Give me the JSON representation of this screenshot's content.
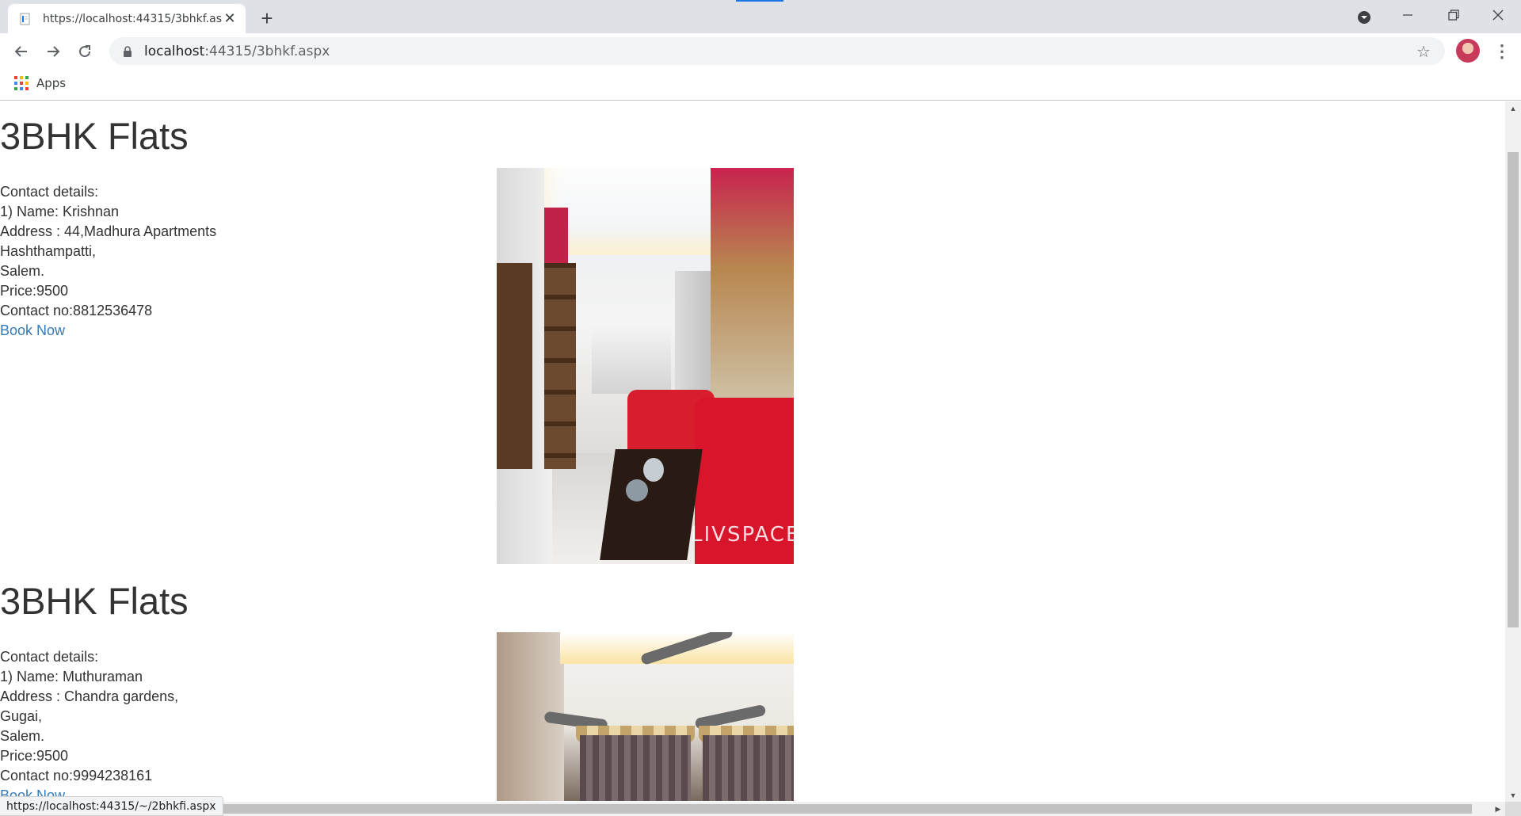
{
  "browser": {
    "tab_title": "https://localhost:44315/3bhkf.aspx",
    "new_tab_label": "+",
    "url_host": "localhost",
    "url_rest": ":44315/3bhkf.aspx",
    "bookmarks": {
      "apps_label": "Apps"
    },
    "status_url": "https://localhost:44315/~/2bhkfi.aspx"
  },
  "listings": [
    {
      "title": "3BHK Flats",
      "contact_heading": "Contact details:",
      "name": "1) Name: Krishnan",
      "address": "Address : 44,Madhura Apartments",
      "area": "Hashthampatti,",
      "city": "Salem.",
      "price": "Price:9500",
      "contact": "Contact no:8812536478",
      "book_label": "Book Now",
      "photo_watermark": "LIVSPACE"
    },
    {
      "title": "3BHK Flats",
      "contact_heading": "Contact details:",
      "name": "1) Name: Muthuraman",
      "address": "Address : Chandra gardens,",
      "area": "Gugai,",
      "city": "Salem.",
      "price": "Price:9500",
      "contact": "Contact no:9994238161",
      "book_label": "Book Now"
    }
  ],
  "colors": {
    "link": "#337ab7",
    "text": "#333333",
    "chrome_bg": "#dee1e6",
    "accent": "#1a73e8"
  }
}
